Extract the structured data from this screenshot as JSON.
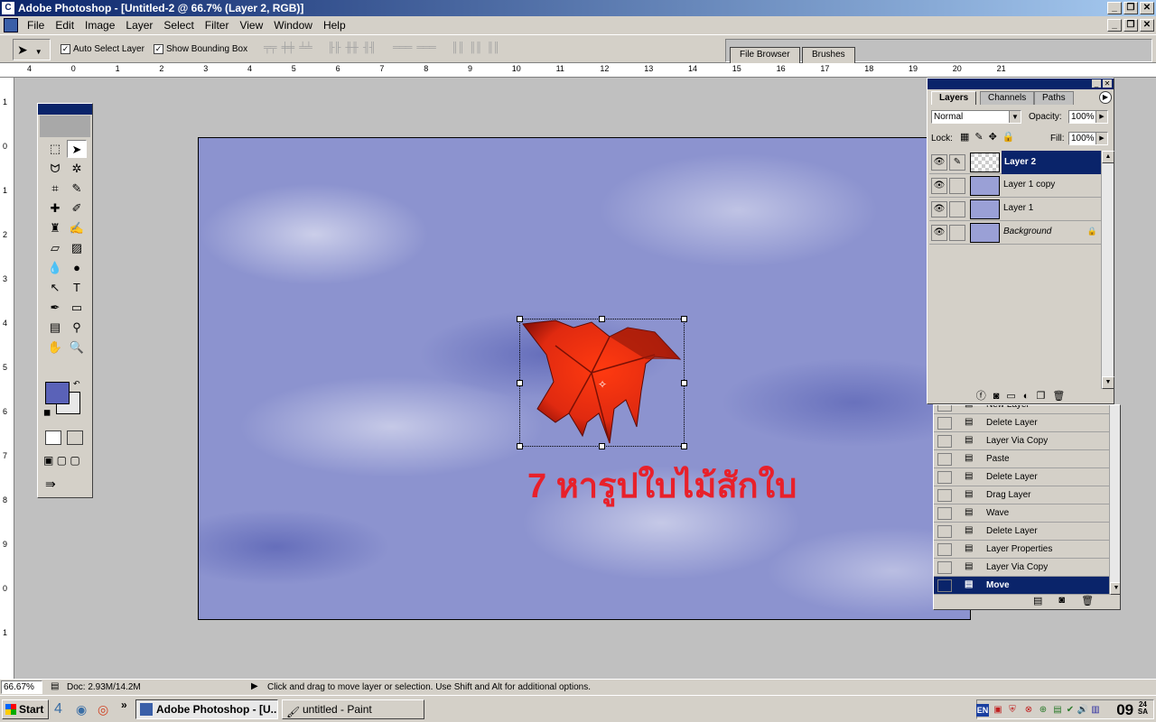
{
  "window": {
    "title": "Adobe Photoshop - [Untitled-2 @ 66.7% (Layer 2, RGB)]"
  },
  "menu": [
    "File",
    "Edit",
    "Image",
    "Layer",
    "Select",
    "Filter",
    "View",
    "Window",
    "Help"
  ],
  "options": {
    "auto_select_layer": "Auto Select Layer",
    "show_bounding_box": "Show Bounding Box",
    "palette_well_tabs": [
      "File Browser",
      "Brushes"
    ]
  },
  "rulers": {
    "h_ticks": [
      "4",
      "0",
      "1",
      "2",
      "3",
      "4",
      "5",
      "6",
      "7",
      "8",
      "9",
      "10",
      "11",
      "12",
      "13",
      "14",
      "15",
      "16",
      "17",
      "18",
      "19",
      "20",
      "21"
    ],
    "v_ticks": [
      "1",
      "0",
      "1",
      "2",
      "3",
      "4",
      "5",
      "6",
      "7",
      "8",
      "9",
      "0",
      "1"
    ]
  },
  "canvas": {
    "caption": "7  หารูปใบไม้สักใบ"
  },
  "layers_panel": {
    "tabs": [
      "Layers",
      "Channels",
      "Paths"
    ],
    "blend_mode": "Normal",
    "opacity_label": "Opacity:",
    "opacity_value": "100%",
    "lock_label": "Lock:",
    "fill_label": "Fill:",
    "fill_value": "100%",
    "layers": [
      {
        "name": "Layer 2",
        "selected": true
      },
      {
        "name": "Layer 1  copy",
        "selected": false
      },
      {
        "name": "Layer 1",
        "selected": false
      },
      {
        "name": "Background",
        "selected": false
      }
    ]
  },
  "history_panel": {
    "items": [
      "New Layer",
      "Delete Layer",
      "Layer Via Copy",
      "Paste",
      "Delete Layer",
      "Drag Layer",
      "Wave",
      "Delete Layer",
      "Layer Properties",
      "Layer Via Copy",
      "Move"
    ],
    "selected": "Move"
  },
  "status": {
    "zoom": "66.67%",
    "doc": "Doc: 2.93M/14.2M",
    "hint": "Click and drag to move layer or selection.  Use Shift and Alt for additional options."
  },
  "taskbar": {
    "start": "Start",
    "buttons": [
      "Adobe Photoshop - [U...",
      "untitled - Paint"
    ],
    "tray_lang": "EN",
    "clock_hour": "09",
    "clock_min": "24",
    "clock_suffix": "SA"
  },
  "colors": {
    "foreground": "#5a62b8",
    "background": "#e8e8e8",
    "title_bar": "#0a246a",
    "caption": "#e8202a"
  }
}
